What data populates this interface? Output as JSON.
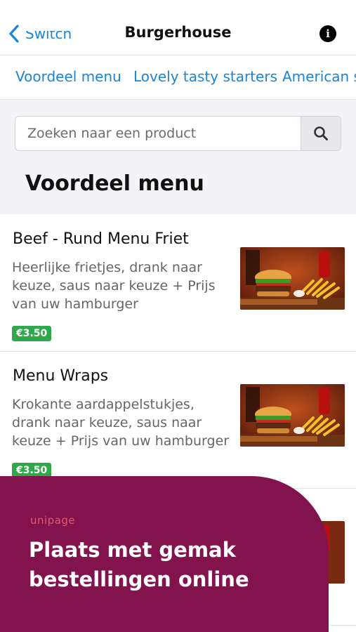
{
  "nav": {
    "back_label": "Switch",
    "title": "Burgerhouse"
  },
  "tabs": [
    {
      "label": "Voordeel menu"
    },
    {
      "label": "Lovely tasty starters"
    },
    {
      "label": "American specials"
    }
  ],
  "search": {
    "placeholder": "Zoeken naar een product",
    "value": ""
  },
  "section": {
    "title": "Voordeel menu"
  },
  "items": [
    {
      "name": "Beef - Rund Menu Friet",
      "description": "Heerlijke frietjes, drank naar keuze, saus naar keuze + Prijs van uw hamburger",
      "price": "€3.50"
    },
    {
      "name": "Menu Wraps",
      "description": "Krokante aardappelstukjes, drank naar keuze, saus naar keuze + Prijs van uw hamburger",
      "price": "€3.50"
    }
  ],
  "promo": {
    "brand": "unipage",
    "text": "Plaats met gemak bestellingen online"
  },
  "colors": {
    "accent": "#1a85d6",
    "price_badge": "#2ea84a",
    "promo_bg": "#82134c"
  }
}
